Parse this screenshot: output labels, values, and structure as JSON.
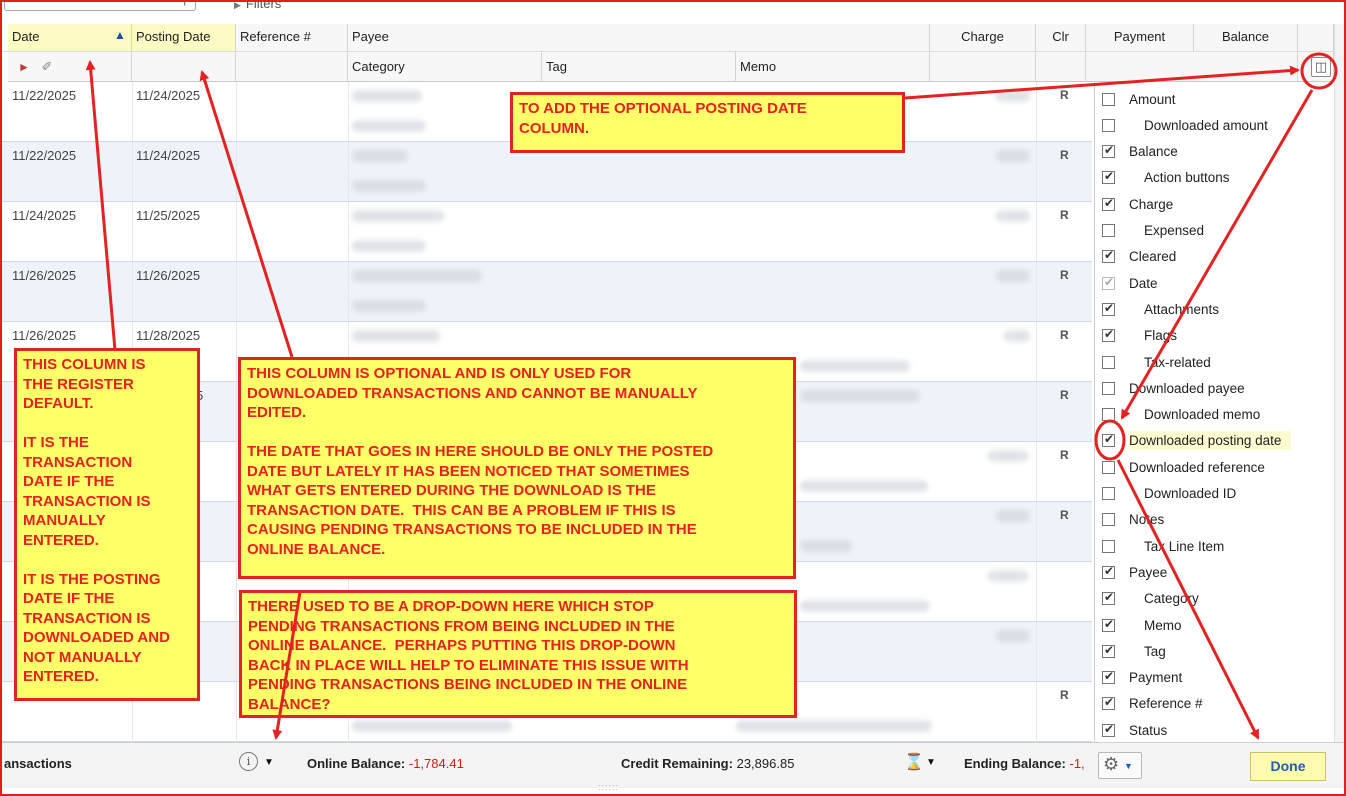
{
  "toolbar": {
    "filters_label": "Filters"
  },
  "columns_row1": {
    "date": "Date",
    "posting_date": "Posting Date",
    "reference": "Reference #",
    "payee": "Payee",
    "charge": "Charge",
    "clr": "Clr",
    "payment": "Payment",
    "balance": "Balance"
  },
  "columns_row2": {
    "category": "Category",
    "tag": "Tag",
    "memo": "Memo"
  },
  "rows": [
    {
      "date": "11/22/2025",
      "posting_date": "11/24/2025",
      "clr": "R"
    },
    {
      "date": "11/22/2025",
      "posting_date": "11/24/2025",
      "clr": "R"
    },
    {
      "date": "11/24/2025",
      "posting_date": "11/25/2025",
      "clr": "R"
    },
    {
      "date": "11/26/2025",
      "posting_date": "11/26/2025",
      "clr": "R"
    },
    {
      "date": "11/26/2025",
      "posting_date": "11/28/2025",
      "clr": "R"
    },
    {
      "date": "",
      "posting_date": "5",
      "clr": "R"
    },
    {
      "date": "",
      "posting_date": "",
      "clr": "R"
    },
    {
      "date": "",
      "posting_date": "",
      "clr": "R"
    },
    {
      "date": "",
      "posting_date": "",
      "clr": ""
    },
    {
      "date": "",
      "posting_date": "",
      "clr": ""
    },
    {
      "date": "",
      "posting_date": "",
      "clr": "R"
    }
  ],
  "column_options": [
    {
      "label": "Amount",
      "checked": false,
      "sub": false
    },
    {
      "label": "Downloaded amount",
      "checked": false,
      "sub": true
    },
    {
      "label": "Balance",
      "checked": true,
      "sub": false
    },
    {
      "label": "Action buttons",
      "checked": true,
      "sub": true
    },
    {
      "label": "Charge",
      "checked": true,
      "sub": false
    },
    {
      "label": "Expensed",
      "checked": false,
      "sub": true
    },
    {
      "label": "Cleared",
      "checked": true,
      "sub": false
    },
    {
      "label": "Date",
      "checked": "disabled",
      "sub": false
    },
    {
      "label": "Attachments",
      "checked": true,
      "sub": true
    },
    {
      "label": "Flags",
      "checked": true,
      "sub": true
    },
    {
      "label": "Tax-related",
      "checked": false,
      "sub": true
    },
    {
      "label": "Downloaded payee",
      "checked": false,
      "sub": false
    },
    {
      "label": "Downloaded memo",
      "checked": false,
      "sub": true
    },
    {
      "label": "Downloaded posting date",
      "checked": true,
      "sub": false,
      "highlight": true
    },
    {
      "label": "Downloaded reference",
      "checked": false,
      "sub": false
    },
    {
      "label": "Downloaded ID",
      "checked": false,
      "sub": true
    },
    {
      "label": "Notes",
      "checked": false,
      "sub": false
    },
    {
      "label": "Tax Line Item",
      "checked": false,
      "sub": true
    },
    {
      "label": "Payee",
      "checked": true,
      "sub": false
    },
    {
      "label": "Category",
      "checked": true,
      "sub": true
    },
    {
      "label": "Memo",
      "checked": true,
      "sub": true
    },
    {
      "label": "Tag",
      "checked": true,
      "sub": true
    },
    {
      "label": "Payment",
      "checked": true,
      "sub": false
    },
    {
      "label": "Reference #",
      "checked": true,
      "sub": false
    },
    {
      "label": "Status",
      "checked": true,
      "sub": false
    }
  ],
  "bottom": {
    "transactions_label": "ansactions",
    "online_balance_label": "Online Balance:",
    "online_balance_value": "-1,784.41",
    "credit_remaining_label": "Credit Remaining:",
    "credit_remaining_value": "23,896.85",
    "ending_balance_label": "Ending Balance:",
    "ending_balance_value": "-1,",
    "done_label": "Done"
  },
  "callouts": {
    "posting_date_add": "TO ADD THE OPTIONAL POSTING DATE\nCOLUMN.",
    "date_column": "THIS COLUMN IS\nTHE REGISTER\nDEFAULT.\n\nIT IS THE\nTRANSACTION\nDATE IF THE\nTRANSACTION IS\nMANUALLY\nENTERED.\n\nIT IS THE POSTING\nDATE IF THE\nTRANSACTION IS\nDOWNLOADED AND\nNOT MANUALLY\nENTERED.",
    "optional_column": "THIS COLUMN IS OPTIONAL AND IS ONLY USED FOR\nDOWNLOADED TRANSACTIONS AND CANNOT BE MANUALLY\nEDITED.\n\nTHE DATE THAT GOES IN HERE SHOULD BE ONLY THE POSTED\nDATE BUT LATELY IT HAS BEEN NOTICED THAT SOMETIMES\nWHAT GETS ENTERED DURING THE DOWNLOAD IS THE\nTRANSACTION DATE.  THIS CAN BE A PROBLEM IF THIS IS\nCAUSING PENDING TRANSACTIONS TO BE INCLUDED IN THE\nONLINE BALANCE.",
    "dropdown": "THERE USED TO BE A DROP-DOWN HERE WHICH STOP\nPENDING TRANSACTIONS FROM BEING INCLUDED IN THE\nONLINE BALANCE.  PERHAPS PUTTING THIS DROP-DOWN\nBACK IN PLACE WILL HELP TO ELIMINATE THIS ISSUE WITH\nPENDING TRANSACTIONS BEING INCLUDED IN THE ONLINE\nBALANCE?"
  },
  "colors": {
    "annotation_red": "#e32222",
    "callout_yellow": "#ffff6a",
    "negative_red": "#d21a1a",
    "sort_arrow_blue": "#1a4fa0"
  }
}
